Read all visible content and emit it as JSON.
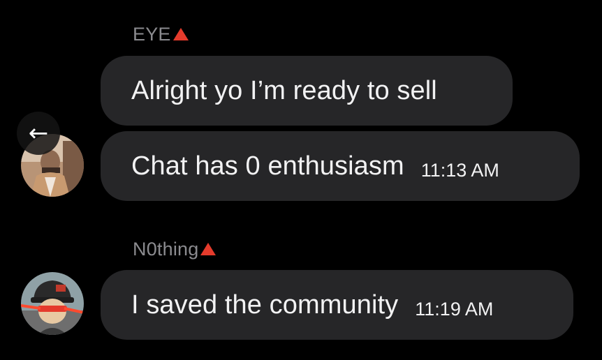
{
  "messages": [
    {
      "sender": "EYE",
      "bubbles": [
        {
          "text": "Alright yo I’m ready to sell",
          "time": ""
        },
        {
          "text": "Chat has 0 enthusiasm",
          "time": "11:13 AM"
        }
      ]
    },
    {
      "sender": "N0thing",
      "bubbles": [
        {
          "text": "I saved the community",
          "time": "11:19 AM"
        }
      ]
    }
  ],
  "colors": {
    "background": "#000000",
    "bubble": "#262628",
    "sender_name": "#8b8b8f",
    "badge": "#e53b2c",
    "text": "#f2f2f3"
  },
  "icons": {
    "back": "arrow-left-icon",
    "badge": "red-triangle-icon"
  }
}
